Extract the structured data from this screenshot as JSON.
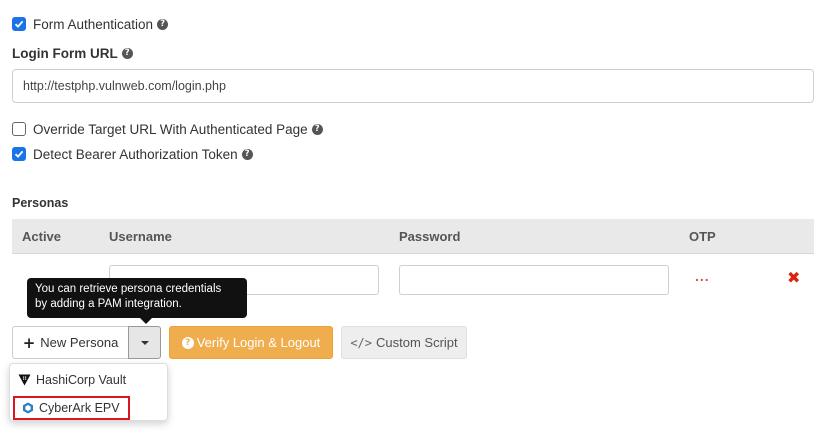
{
  "form_auth": {
    "label": "Form Authentication",
    "checked": true
  },
  "login_form_url": {
    "label": "Login Form URL",
    "value": "http://testphp.vulnweb.com/login.php"
  },
  "override_target": {
    "label": "Override Target URL With Authenticated Page",
    "checked": false
  },
  "detect_bearer": {
    "label": "Detect Bearer Authorization Token",
    "checked": true
  },
  "personas": {
    "section_label": "Personas",
    "columns": [
      "Active",
      "Username",
      "Password",
      "OTP"
    ],
    "row": {
      "username": "",
      "password": "",
      "otp": "..."
    }
  },
  "tooltip": {
    "line1": "You can retrieve persona credentials",
    "line2": "by adding a PAM integration."
  },
  "buttons": {
    "new_persona": "New Persona",
    "verify": "Verify Login & Logout",
    "custom_script": "Custom Script"
  },
  "dropdown": {
    "items": [
      "HashiCorp Vault",
      "CyberArk EPV"
    ]
  },
  "colors": {
    "accent": "#1a73e8",
    "warning": "#f0ad4e",
    "danger": "#d9230f",
    "highlight": "#d9171e"
  },
  "icons": [
    "check-icon",
    "help-icon",
    "plus-icon",
    "caret-down-icon",
    "question-circle-icon",
    "code-icon",
    "remove-icon",
    "hashicorp-vault-icon",
    "cyberark-icon"
  ]
}
